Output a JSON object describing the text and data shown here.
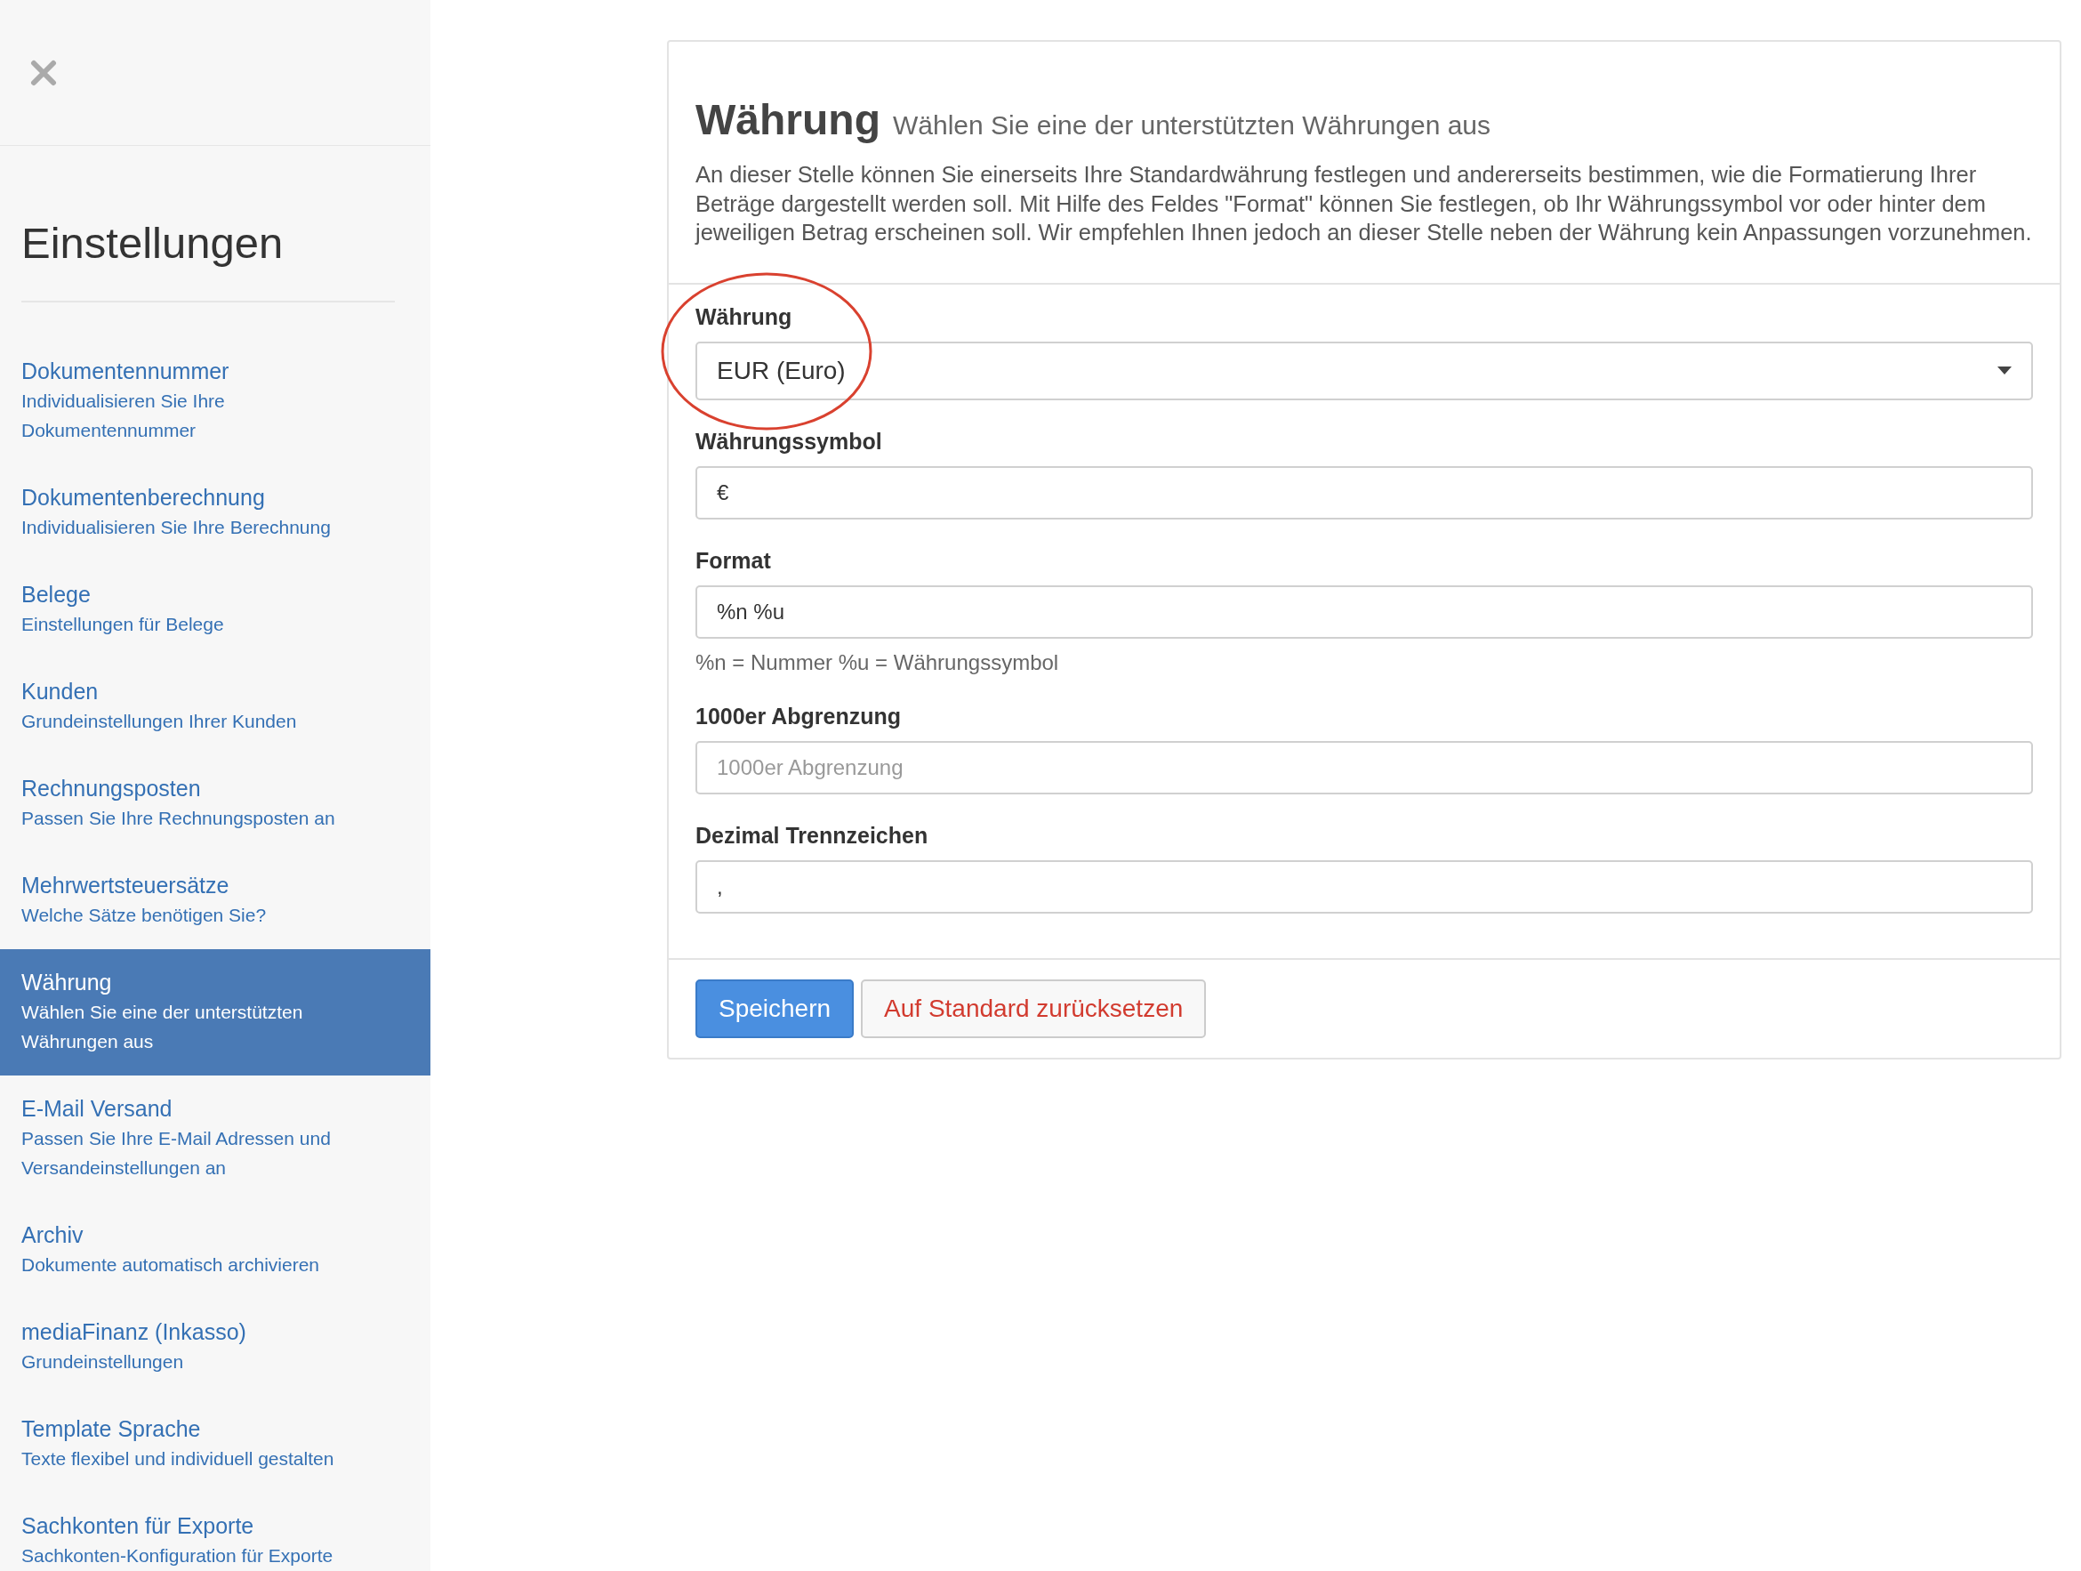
{
  "sidebar": {
    "title": "Einstellungen",
    "items": [
      {
        "title": "Dokumentennummer",
        "subtitle": "Individualisieren Sie Ihre Dokumentennummer",
        "selected": false
      },
      {
        "title": "Dokumentenberechnung",
        "subtitle": "Individualisieren Sie Ihre Berechnung",
        "selected": false
      },
      {
        "title": "Belege",
        "subtitle": "Einstellungen für Belege",
        "selected": false
      },
      {
        "title": "Kunden",
        "subtitle": "Grundeinstellungen Ihrer Kunden",
        "selected": false
      },
      {
        "title": "Rechnungsposten",
        "subtitle": "Passen Sie Ihre Rechnungsposten an",
        "selected": false
      },
      {
        "title": "Mehrwertsteuersätze",
        "subtitle": "Welche Sätze benötigen Sie?",
        "selected": false
      },
      {
        "title": "Währung",
        "subtitle": "Wählen Sie eine der unterstützten Währungen aus",
        "selected": true
      },
      {
        "title": "E-Mail Versand",
        "subtitle": "Passen Sie Ihre E-Mail Adressen und Versandeinstellungen an",
        "selected": false
      },
      {
        "title": "Archiv",
        "subtitle": "Dokumente automatisch archivieren",
        "selected": false
      },
      {
        "title": "mediaFinanz (Inkasso)",
        "subtitle": "Grundeinstellungen",
        "selected": false
      },
      {
        "title": "Template Sprache",
        "subtitle": "Texte flexibel und individuell gestalten",
        "selected": false
      },
      {
        "title": "Sachkonten für Exporte",
        "subtitle": "Sachkonten-Konfiguration für Exporte",
        "selected": false
      }
    ]
  },
  "panel": {
    "title": "Währung",
    "subtitle": "Wählen Sie eine der unterstützten Währungen aus",
    "description": "An dieser Stelle können Sie einerseits Ihre Standardwährung festlegen und andererseits bestimmen, wie die Formatierung Ihrer Beträge dargestellt werden soll. Mit Hilfe des Feldes \"Format\" können Sie festlegen, ob Ihr Währungssymbol vor oder hinter dem jeweiligen Betrag erscheinen soll. Wir empfehlen Ihnen jedoch an dieser Stelle neben der Währung kein Anpassungen vorzunehmen.",
    "fields": [
      {
        "kind": "select",
        "label": "Währung",
        "value": "EUR (Euro)",
        "highlight": true
      },
      {
        "kind": "input",
        "label": "Währungssymbol",
        "value": "€"
      },
      {
        "kind": "input",
        "label": "Format",
        "value": "%n %u",
        "help": "%n = Nummer %u = Währungssymbol"
      },
      {
        "kind": "input",
        "label": "1000er Abgrenzung",
        "placeholder": "1000er Abgrenzung"
      },
      {
        "kind": "input",
        "label": "Dezimal Trennzeichen",
        "value": ","
      }
    ],
    "buttons": [
      {
        "kind": "primary",
        "label": "Speichern"
      },
      {
        "kind": "reset",
        "label": "Auf Standard zurücksetzen"
      }
    ]
  }
}
